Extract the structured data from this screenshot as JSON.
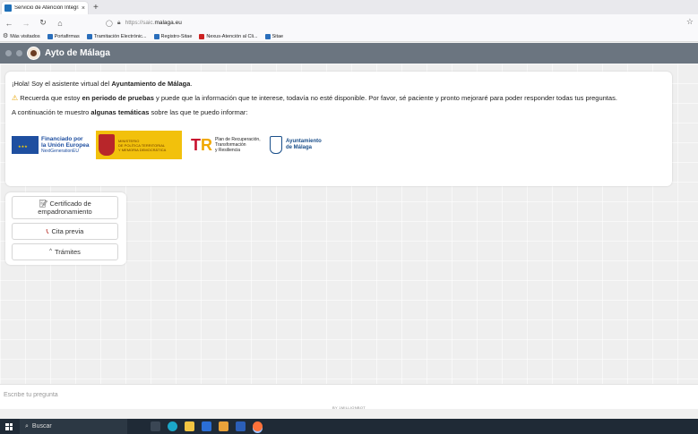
{
  "browser": {
    "tab_title": "Servicio de Atención Integral a",
    "tab_close": "×",
    "new_tab": "+",
    "url_prefix": "https://saic.",
    "url_domain": "malaga.eu",
    "bookmarks": [
      "Más visitados",
      "Portafirmas",
      "Tramitación Electrónic...",
      "Registro-Sitae",
      "Nexus-Atención al Cli...",
      "Sitae"
    ]
  },
  "app": {
    "title": "Ayto de Málaga"
  },
  "welcome": {
    "greeting_pre": "¡Hola! Soy el asistente virtual del ",
    "greeting_bold": "Ayuntamiento de Málaga",
    "greeting_post": ".",
    "warn_pre": " Recuerda que estoy ",
    "warn_bold": "en periodo de pruebas",
    "warn_post": " y puede que la información que te interese, todavía no esté disponible. Por favor, sé paciente y pronto mejoraré para poder responder todas tus preguntas.",
    "topics_pre": "A continuación te muestro ",
    "topics_bold": "algunas temáticas",
    "topics_post": " sobre las que te puedo informar:"
  },
  "logos": {
    "eu": [
      "Financiado por",
      "la Unión Europea",
      "NextGenerationEU"
    ],
    "ministry": [
      "MINISTERIO",
      "DE POLÍTICA TERRITORIAL",
      "Y MEMORIA DEMOCRÁTICA"
    ],
    "prtr": [
      "Plan de Recuperación,",
      "Transformación",
      "y Resiliencia"
    ],
    "ayto": [
      "Ayuntamiento",
      "de Málaga"
    ]
  },
  "options": [
    {
      "label": "Certificado de empadronamiento",
      "icon": "certificate-icon"
    },
    {
      "label": "Cita previa",
      "icon": "phone-icon"
    },
    {
      "label": "Trámites",
      "icon": "chevron-up-icon"
    }
  ],
  "input": {
    "placeholder": "Escribe tu pregunta",
    "powered_by": "BY 1MILLIONBOT"
  },
  "taskbar": {
    "search_label": "Buscar"
  }
}
